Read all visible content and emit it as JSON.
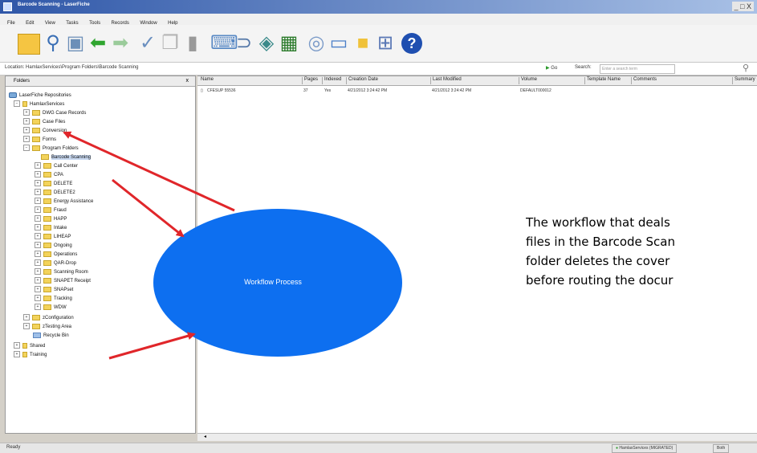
{
  "window": {
    "title": "Barcode Scanning - LaserFiche",
    "controls": "_ □ X"
  },
  "menu": [
    "File",
    "Edit",
    "View",
    "Tasks",
    "Tools",
    "Records",
    "Window",
    "Help"
  ],
  "toolbar": {
    "icons": [
      "folder-icon",
      "search-icon",
      "document-icon",
      "back-arrow-icon",
      "forward-arrow-icon",
      "tools-icon",
      "copy-icon",
      "paste-icon",
      "scan-icon",
      "link-icon",
      "globe-icon",
      "save-icon",
      "refresh-icon",
      "panel-icon",
      "folder-small-icon",
      "grid-icon",
      "help-icon"
    ]
  },
  "address": {
    "label": "Location: HamlaxServices\\Program Folders\\Barcode Scanning",
    "go_label": "Go",
    "search_label": "Search:",
    "search_placeholder": "Enter a search term"
  },
  "folders_pane": {
    "title": "Folders",
    "close": "x",
    "tree": [
      {
        "label": "LaserFiche Repositories",
        "icon": "repository-icon"
      },
      {
        "label": "HamlaxServices",
        "icon": "database-icon"
      },
      {
        "label": "DWG Case Records",
        "icon": "folder-icon"
      },
      {
        "label": "Case Files",
        "icon": "folder-icon"
      },
      {
        "label": "Conversion",
        "icon": "folder-icon"
      },
      {
        "label": "Forms",
        "icon": "folder-icon"
      },
      {
        "label": "Program Folders",
        "icon": "folder-icon"
      },
      {
        "label": "Barcode Scanning",
        "icon": "folder-icon"
      },
      {
        "label": "Call Center",
        "icon": "folder-icon"
      },
      {
        "label": "CPA",
        "icon": "folder-icon"
      },
      {
        "label": "DELETE",
        "icon": "folder-icon"
      },
      {
        "label": "DELETE2",
        "icon": "folder-icon"
      },
      {
        "label": "Energy Assistance",
        "icon": "folder-icon"
      },
      {
        "label": "Fraud",
        "icon": "folder-icon"
      },
      {
        "label": "HAPP",
        "icon": "folder-icon"
      },
      {
        "label": "Intake",
        "icon": "folder-icon"
      },
      {
        "label": "LIHEAP",
        "icon": "folder-icon"
      },
      {
        "label": "Ongoing",
        "icon": "folder-icon"
      },
      {
        "label": "Operations",
        "icon": "folder-icon"
      },
      {
        "label": "QAR-Drop",
        "icon": "folder-icon"
      },
      {
        "label": "Scanning Room",
        "icon": "folder-icon"
      },
      {
        "label": "SNAPET Receipt",
        "icon": "folder-icon"
      },
      {
        "label": "SNAPset",
        "icon": "folder-icon"
      },
      {
        "label": "Tracking",
        "icon": "folder-icon"
      },
      {
        "label": "WDW",
        "icon": "folder-icon"
      },
      {
        "label": "zConfiguration",
        "icon": "folder-icon"
      },
      {
        "label": "zTesting Area",
        "icon": "folder-icon"
      },
      {
        "label": "Recycle Bin",
        "icon": "recycle-bin-icon"
      },
      {
        "label": "Shared",
        "icon": "database-icon"
      },
      {
        "label": "Training",
        "icon": "database-icon"
      }
    ]
  },
  "list": {
    "columns": [
      "Name",
      "Pages",
      "Indexed",
      "Creation Date",
      "Last Modified",
      "Volume",
      "Template Name",
      "Comments",
      "Summary"
    ],
    "rows": [
      [
        "CFESUP 55536",
        "37",
        "Yes",
        "4/21/2012 3:24:42 PM",
        "4/21/2012 3:24:42 PM",
        "DEFAULT000012",
        "",
        "",
        ""
      ]
    ]
  },
  "status": {
    "left": "Ready",
    "server": "HamlaxServices (MIGRATED)",
    "right": "Both"
  },
  "annotation": {
    "ellipse_label": "Workflow Process",
    "ellipse_color": "#0d6ff0",
    "arrow_color": "#e0262a",
    "note_lines": [
      "The workflow that deals",
      "files in the Barcode Scan",
      "folder deletes the cover",
      "before routing the docur"
    ]
  }
}
